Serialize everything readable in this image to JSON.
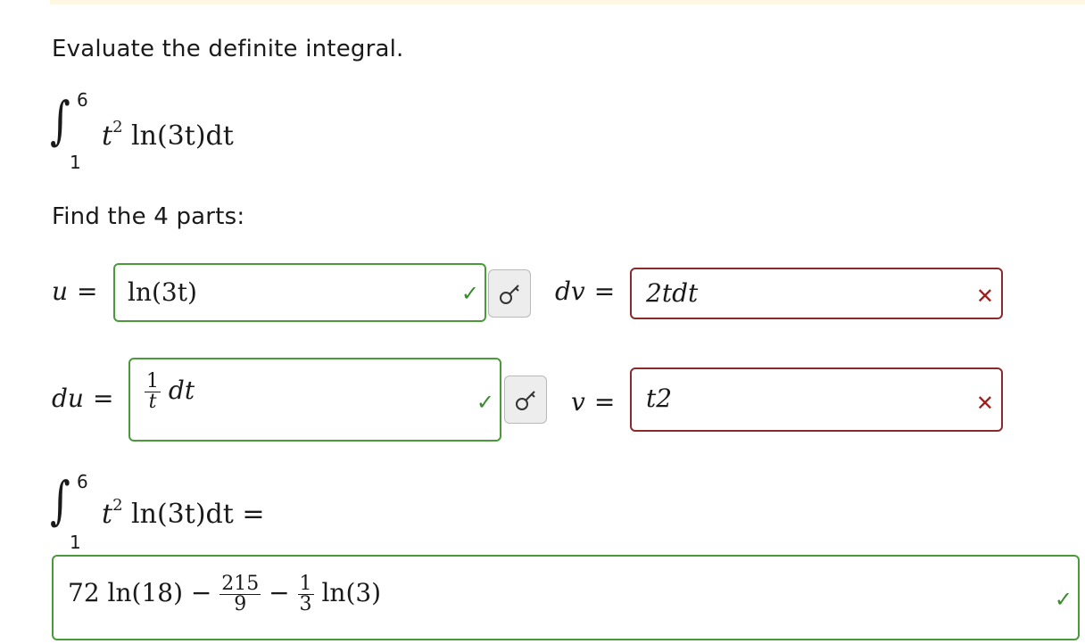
{
  "prompt": "Evaluate the definite integral.",
  "integral": {
    "upper": "6",
    "lower": "1",
    "integrand_base": "t",
    "integrand_power": "2",
    "integrand_rest": " ln(3t)dt"
  },
  "find_text": "Find the 4 parts:",
  "parts": {
    "u": {
      "label": "u",
      "value": "ln(3t)",
      "status": "correct"
    },
    "dv": {
      "label": "dv",
      "value": "2tdt",
      "status": "incorrect"
    },
    "du": {
      "label": "du",
      "numerator": "1",
      "denominator": "t",
      "suffix": "dt",
      "status": "correct"
    },
    "v": {
      "label": "v",
      "value": "t2",
      "status": "incorrect"
    }
  },
  "equals": "=",
  "result": {
    "upper": "6",
    "lower": "1",
    "answer_part1": "72 ln(18) −",
    "frac1_num": "215",
    "frac1_den": "9",
    "minus": "−",
    "frac2_num": "1",
    "frac2_den": "3",
    "answer_part2": "ln(3)",
    "status": "correct"
  },
  "icons": {
    "check": "check-icon",
    "cross": "cross-icon",
    "key": "key-icon"
  },
  "colors": {
    "correct": "#4a9a3a",
    "incorrect": "#8b2a2a",
    "top_strip": "#fdf7e4"
  }
}
